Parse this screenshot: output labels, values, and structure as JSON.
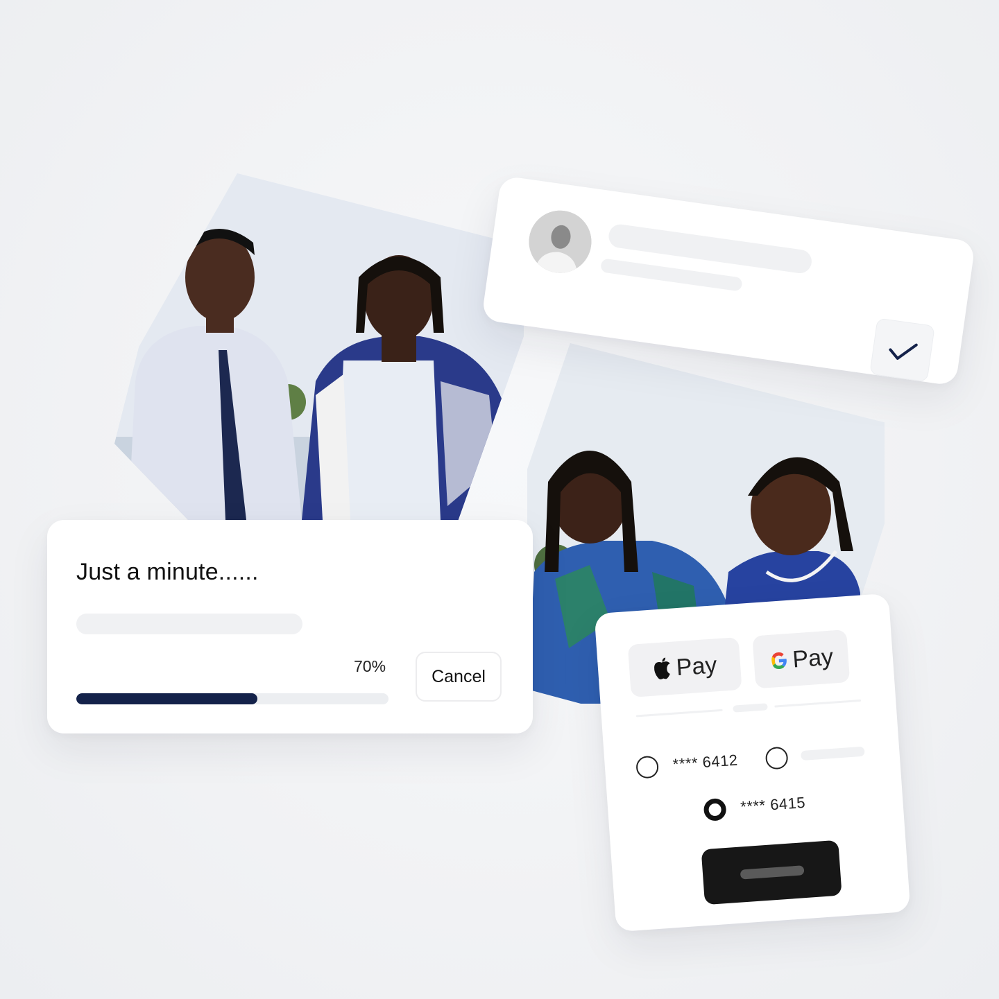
{
  "progress_dialog": {
    "title": "Just a minute......",
    "percent_label": "70%",
    "progress": 0.7,
    "cancel_label": "Cancel",
    "bar_color": "#14224a"
  },
  "profile_card": {
    "avatar": "person-avatar",
    "status_icon": "checkmark-icon"
  },
  "payment_card": {
    "apple_pay_label": "Pay",
    "google_pay_label": "Pay",
    "cards": [
      {
        "number": "**** 6412",
        "selected": false
      },
      {
        "number": "**** 6415",
        "selected": true
      }
    ]
  },
  "colors": {
    "accent": "#14224a",
    "primary_button": "#171717"
  }
}
